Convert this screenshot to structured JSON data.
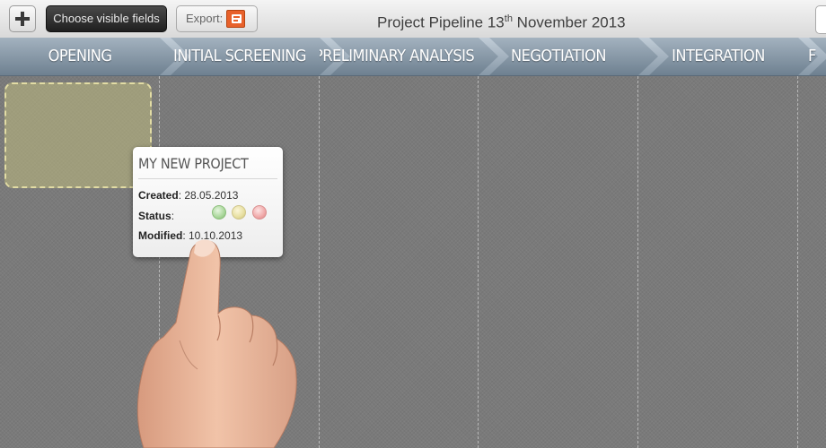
{
  "toolbar": {
    "add_label": "+",
    "fields_label": "Choose visible fields",
    "export_label": "Export:",
    "export_icon": "powerpoint-icon",
    "title_prefix": "Project Pipeline 13",
    "title_sup": "th",
    "title_suffix": " November 2013"
  },
  "stages": [
    {
      "label": "OPENING"
    },
    {
      "label": "INITIAL SCREENING"
    },
    {
      "label": "PRELIMINARY ANALYSIS"
    },
    {
      "label": "NEGOTIATION"
    },
    {
      "label": "INTEGRATION"
    },
    {
      "label": "F"
    }
  ],
  "card": {
    "title": "MY NEW PROJECT",
    "created_label": "Created",
    "created_value": ": 28.05.2013",
    "status_label": "Status",
    "status_colon": ":",
    "modified_label": "Modified",
    "modified_value": ": 10.10.2013",
    "status_colors": [
      "#a9d79a",
      "#e7dfa0",
      "#f0a8a8"
    ]
  },
  "colors": {
    "stage_bar": "#7f909e",
    "board": "#7a7a7a",
    "placeholder_border": "#e2dca4"
  }
}
